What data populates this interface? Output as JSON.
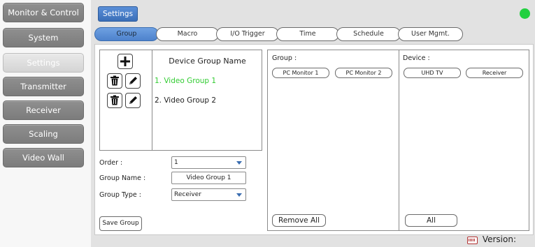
{
  "sidebar": {
    "items": [
      {
        "label": "Monitor & Control",
        "active": false
      },
      {
        "label": "System",
        "active": false
      },
      {
        "label": "Settings",
        "active": true
      },
      {
        "label": "Transmitter",
        "active": false
      },
      {
        "label": "Receiver",
        "active": false
      },
      {
        "label": "Scaling",
        "active": false
      },
      {
        "label": "Video Wall",
        "active": false
      }
    ]
  },
  "header": {
    "badge": "Settings",
    "status_color": "#22d040"
  },
  "tabs": [
    {
      "label": "Group",
      "active": true
    },
    {
      "label": "Macro",
      "active": false
    },
    {
      "label": "I/O Trigger",
      "active": false
    },
    {
      "label": "Time",
      "active": false
    },
    {
      "label": "Schedule",
      "active": false
    },
    {
      "label": "User Mgmt.",
      "active": false
    }
  ],
  "device_groups": {
    "header": "Device Group Name",
    "add_icon": "plus-icon",
    "items": [
      {
        "label": "1. Video Group 1",
        "selected": true,
        "delete_icon": "trash-icon",
        "edit_icon": "pencil-icon"
      },
      {
        "label": "2. Video Group 2",
        "selected": false,
        "delete_icon": "trash-icon",
        "edit_icon": "pencil-icon"
      }
    ]
  },
  "form": {
    "order_label": "Order :",
    "order_value": "1",
    "group_name_label": "Group Name :",
    "group_name_value": "Video Group 1",
    "group_type_label": "Group Type :",
    "group_type_value": "Receiver",
    "save_label": "Save Group"
  },
  "group_panel": {
    "title": "Group :",
    "chips": [
      "PC Monitor 1",
      "PC Monitor 2"
    ],
    "remove_all_label": "Remove All"
  },
  "device_panel": {
    "title": "Device :",
    "chips": [
      "UHD TV",
      "Receiver"
    ],
    "all_label": "All"
  },
  "footer": {
    "version_label": "Version:",
    "keyboard_icon": "keyboard-icon"
  },
  "colors": {
    "accent_blue": "#4d82cc",
    "selected_green": "#33cc33",
    "nav_gray": "#858585"
  }
}
